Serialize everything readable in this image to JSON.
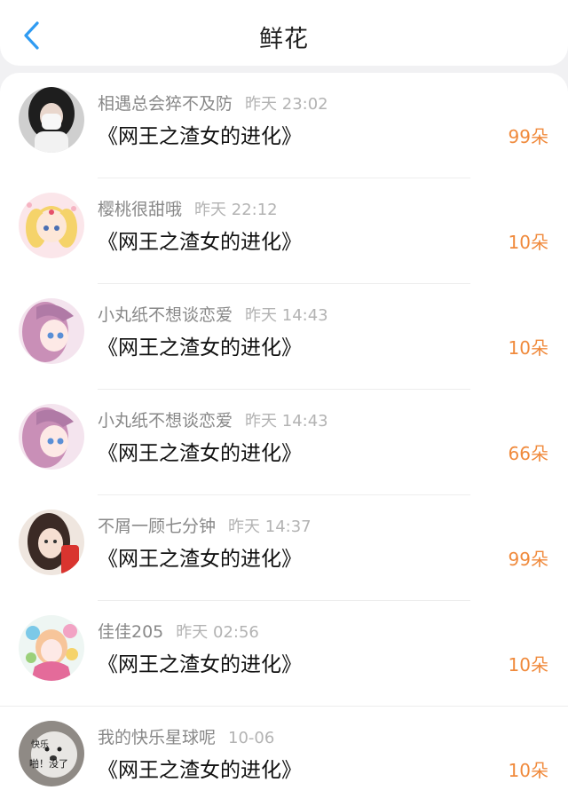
{
  "header": {
    "title": "鲜花",
    "back_icon": "chevron-left-icon",
    "accent": "#2f9bf2"
  },
  "colors": {
    "count": "#f08a3c"
  },
  "items": [
    {
      "name": "相遇总会猝不及防",
      "time": "昨天 23:02",
      "book": "《网王之渣女的进化》",
      "count": "99朵"
    },
    {
      "name": "樱桃很甜哦",
      "time": "昨天 22:12",
      "book": "《网王之渣女的进化》",
      "count": "10朵"
    },
    {
      "name": "小丸纸不想谈恋爱",
      "time": "昨天 14:43",
      "book": "《网王之渣女的进化》",
      "count": "10朵"
    },
    {
      "name": "小丸纸不想谈恋爱",
      "time": "昨天 14:43",
      "book": "《网王之渣女的进化》",
      "count": "66朵"
    },
    {
      "name": "不屑一顾七分钟",
      "time": "昨天 14:37",
      "book": "《网王之渣女的进化》",
      "count": "99朵"
    },
    {
      "name": "佳佳205",
      "time": "昨天 02:56",
      "book": "《网王之渣女的进化》",
      "count": "10朵"
    },
    {
      "name": "我的快乐星球呢",
      "time": "10-06",
      "book": "《网王之渣女的进化》",
      "count": "10朵",
      "avatar_text": [
        "快乐",
        "啪！没了"
      ]
    }
  ]
}
